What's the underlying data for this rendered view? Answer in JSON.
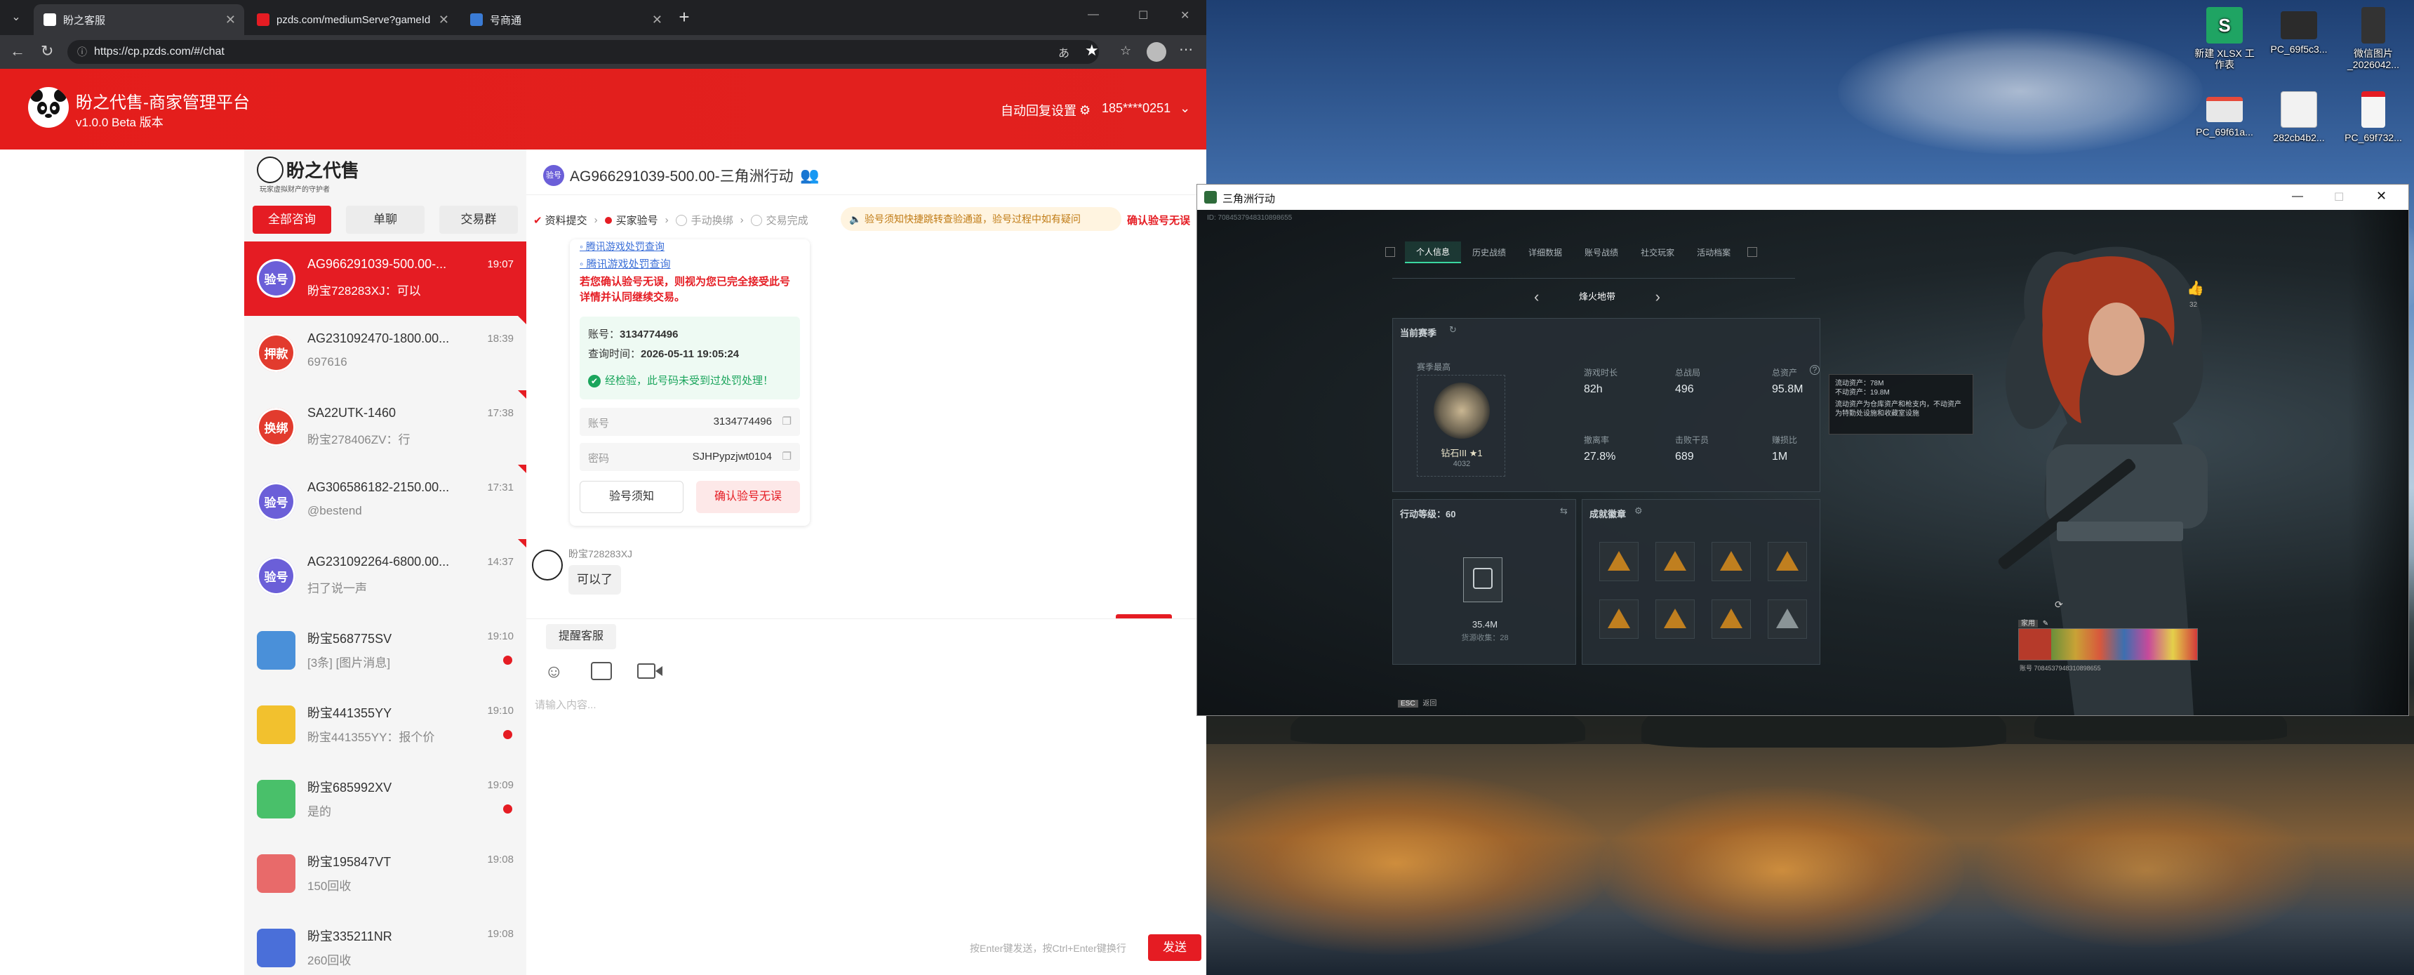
{
  "desktop": {
    "icons": [
      {
        "label": "新建 XLSX 工作表",
        "color": "#1fa463"
      },
      {
        "label": "PC_69f5c3...",
        "color": "#2b2b2b"
      },
      {
        "label": "微信图片_2026042...",
        "color": "#333333"
      },
      {
        "label": "PC_69f61a...",
        "color": "#e8e8e8"
      },
      {
        "label": "282cb4b2...",
        "color": "#f2f2f2"
      },
      {
        "label": "PC_69f732...",
        "color": "#f5f5f5"
      }
    ]
  },
  "browser": {
    "tabs": [
      {
        "label": "盼之客服",
        "favicon_color": "#ffffff",
        "active": true
      },
      {
        "label": "pzds.com/mediumServe?gameId=",
        "favicon_color": "#e51c23",
        "active": false
      },
      {
        "label": "号商通",
        "favicon_color": "#3a7bd5",
        "active": false
      }
    ],
    "new_tab_glyph": "+",
    "url": "https://cp.pzds.com/#/chat",
    "window_controls": [
      "—",
      "☐",
      "✕"
    ]
  },
  "app": {
    "brand_title": "盼之代售-商家管理平台",
    "version": "v1.0.0 Beta 版本",
    "auto_reply": "自动回复设置",
    "user_phone": "185****0251",
    "accent": "#e51c23",
    "sidebar_logo_text": "盼之代售",
    "sidebar_logo_sub": "玩家虚拟财产的守护者",
    "filter_tabs": [
      "全部咨询",
      "单聊",
      "交易群"
    ],
    "conversations": [
      {
        "avatar_text": "验号",
        "avatar_color": "#6b5fd8",
        "name": "AG966291039-500.00-...",
        "time": "19:07",
        "preview": "盼宝728283XJ：可以",
        "active": true,
        "unread": false
      },
      {
        "avatar_text": "押款",
        "avatar_color": "#e23b2e",
        "name": "AG231092470-1800.00...",
        "time": "18:39",
        "preview": "697616",
        "active": false,
        "unread": false
      },
      {
        "avatar_text": "换绑",
        "avatar_color": "#e23b2e",
        "name": "SA22UTK-1460",
        "time": "17:38",
        "preview": "盼宝278406ZV：行",
        "active": false,
        "unread": false
      },
      {
        "avatar_text": "验号",
        "avatar_color": "#6b5fd8",
        "name": "AG306586182-2150.00...",
        "time": "17:31",
        "preview": "@bestend",
        "active": false,
        "unread": false
      },
      {
        "avatar_text": "验号",
        "avatar_color": "#6b5fd8",
        "name": "AG231092264-6800.00...",
        "time": "14:37",
        "preview": "扫了说一声",
        "active": false,
        "unread": false
      },
      {
        "avatar_text": "",
        "avatar_color": "#4a90d9",
        "name": "盼宝568775SV",
        "time": "19:10",
        "preview": "[3条] [图片消息]",
        "active": false,
        "unread": true
      },
      {
        "avatar_text": "",
        "avatar_color": "#f2c12e",
        "name": "盼宝441355YY",
        "time": "19:10",
        "preview": "盼宝441355YY：报个价",
        "active": false,
        "unread": true
      },
      {
        "avatar_text": "",
        "avatar_color": "#49c06a",
        "name": "盼宝685992XV",
        "time": "19:09",
        "preview": "是的",
        "active": false,
        "unread": true
      },
      {
        "avatar_text": "",
        "avatar_color": "#e86a6a",
        "name": "盼宝195847VT",
        "time": "19:08",
        "preview": "150回收",
        "active": false,
        "unread": false
      },
      {
        "avatar_text": "",
        "avatar_color": "#4a6fd9",
        "name": "盼宝335211NR",
        "time": "19:08",
        "preview": "260回收",
        "active": false,
        "unread": false
      }
    ],
    "chat": {
      "title": "AG966291039-500.00-三角洲行动",
      "title_badge": "验号",
      "steps": [
        "资料提交",
        "买家验号",
        "手动换绑",
        "交易完成"
      ],
      "notice": "验号须知快捷跳转查验通道，验号过程中如有疑问",
      "confirm_top": "确认验号无误",
      "links": [
        "腾讯游戏处罚查询"
      ],
      "warning": "若您确认验号无误，则视为您已完全接受此号详情并认同继续交易。",
      "account_label": "账号：",
      "account_value": "3134774496",
      "query_time_label": "查询时间：",
      "query_time_value": "2026-05-11 19:05:24",
      "check_result": "经检验，此号码未受到过处罚处理！",
      "field_account_label": "账号",
      "field_account_value": "3134774496",
      "field_password_label": "密码",
      "field_password_value": "SJHPypzjwt0104",
      "btn_notice": "验号须知",
      "btn_confirm": "确认验号无误",
      "msg_sender": "盼宝728283XJ",
      "msg_text": "可以了",
      "remind_btn": "提醒客服",
      "input_placeholder": "请输入内容...",
      "send_hint": "按Enter键发送，按Ctrl+Enter键换行",
      "send_btn": "发送"
    }
  },
  "game": {
    "window_title": "三角洲行动",
    "id_line": "ID: 7084537948310898655",
    "tabs": [
      "个人信息",
      "历史战绩",
      "详细数据",
      "账号战绩",
      "社交玩家",
      "活动档案"
    ],
    "mode": "烽火地带",
    "section_current": "当前赛季",
    "season_rank_label": "赛季最高",
    "rank_name": "钻石III ★1",
    "rank_score": "4032",
    "stats": [
      {
        "label": "游戏时长",
        "value": "82h"
      },
      {
        "label": "总战局",
        "value": "496"
      },
      {
        "label": "总资产",
        "value": "95.8M"
      },
      {
        "label": "撤离率",
        "value": "27.8%"
      },
      {
        "label": "击败干员",
        "value": "689"
      },
      {
        "label": "赚损比",
        "value": "1M"
      }
    ],
    "tooltip_lines": [
      "流动资产：78M",
      "不动资产：19.8M",
      "流动资产为仓库资产和枪支内，不动资产为特勤处设施和收藏室设施"
    ],
    "action_level": "行动等级：60",
    "collection_value": "35.4M",
    "collection_label": "货源收集：28",
    "achievements_label": "成就徽章",
    "achievements_count": 8,
    "like_count": "32",
    "team_label": "家用",
    "team_id": "账号 7084537948310898655",
    "footer_key": "ESC",
    "footer_text": "返回",
    "accent": "#3bd7a0"
  }
}
